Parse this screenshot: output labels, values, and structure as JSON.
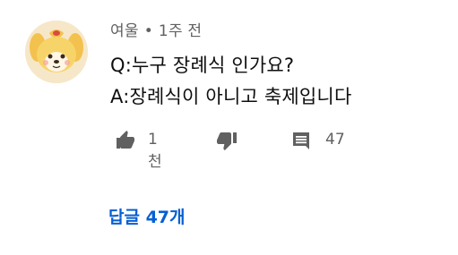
{
  "comment": {
    "author": "여울",
    "separator": "•",
    "time": "1주 전",
    "question": "Q:누구 장례식 인가요?",
    "answer": "A:장례식이 아니고 축제입니다"
  },
  "actions": {
    "like_icon": "thumb-up-icon",
    "like_count": "1천",
    "dislike_icon": "thumb-down-icon",
    "reply_icon": "comment-icon",
    "reply_count": "47"
  },
  "replies_link": "답글 47개",
  "colors": {
    "meta_text": "#606060",
    "body_text": "#0f0f0f",
    "icon": "#606060",
    "link": "#065fd4"
  }
}
